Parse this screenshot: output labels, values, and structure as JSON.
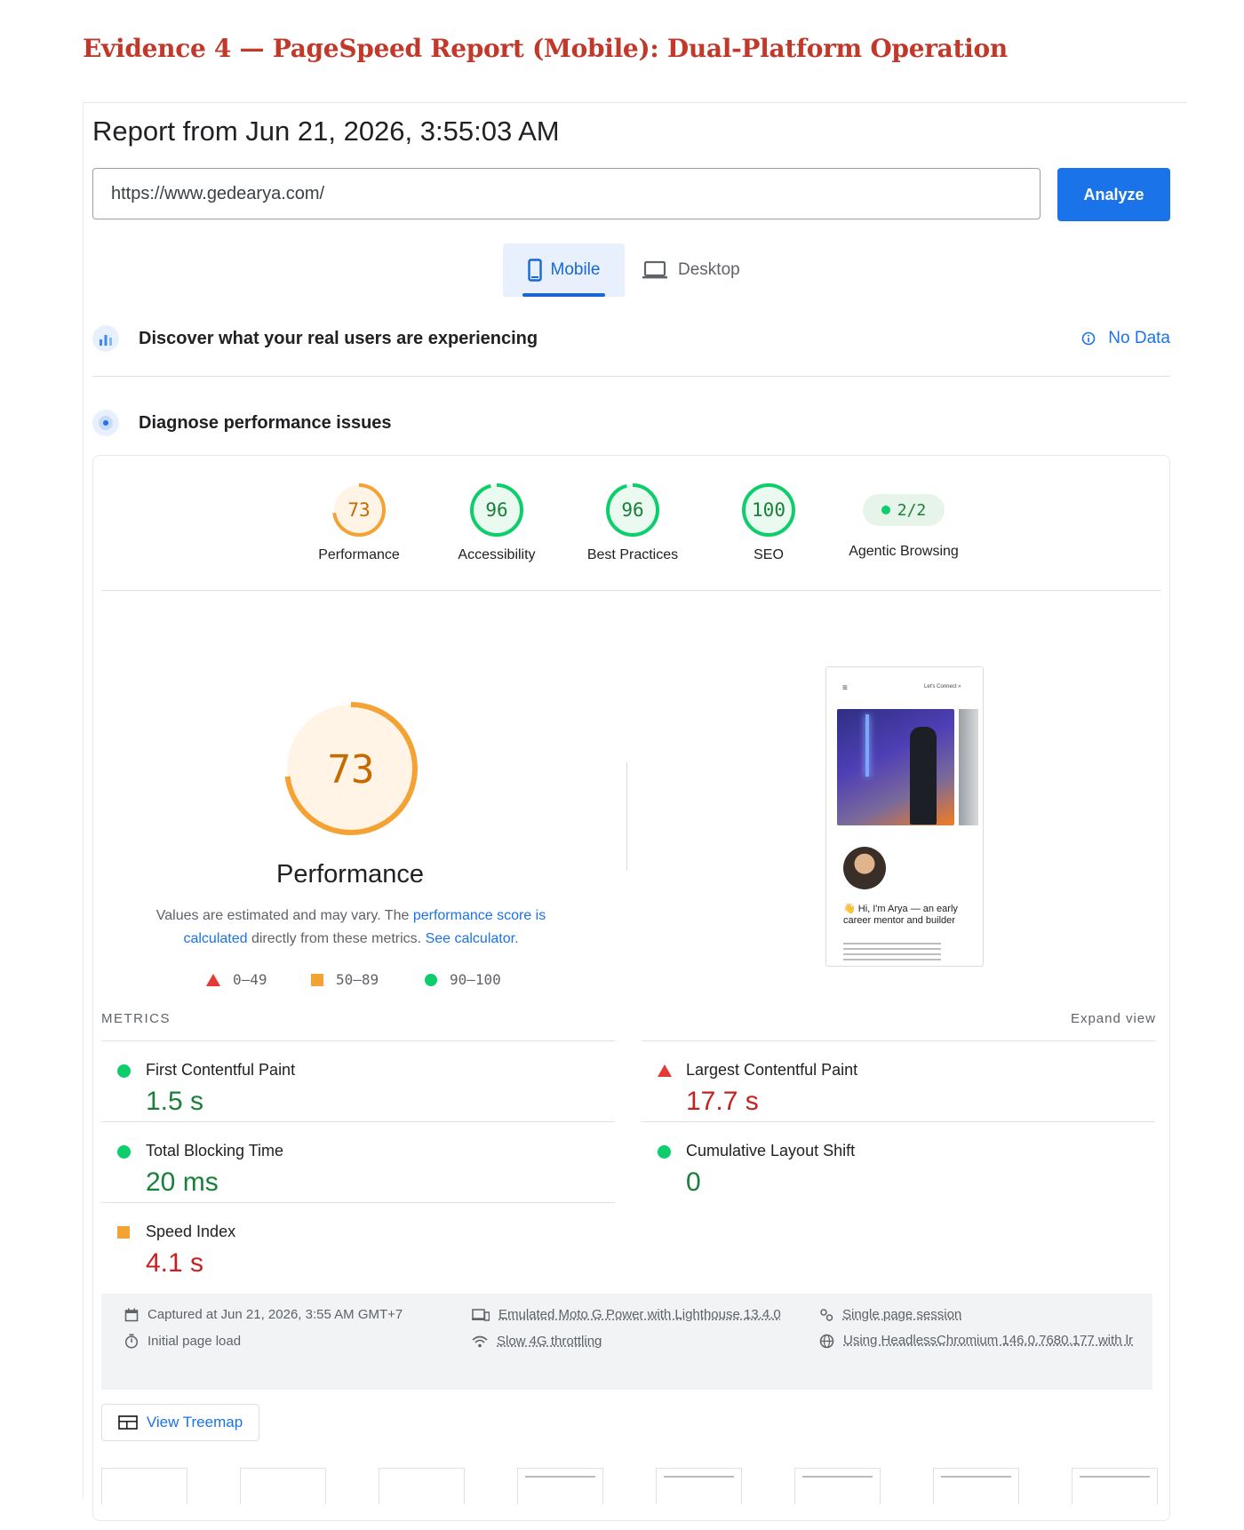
{
  "heading": "Evidence 4 — PageSpeed Report (Mobile): Dual-Platform Operation",
  "report": {
    "title": "Report from Jun 21, 2026, 3:55:03 AM",
    "url_value": "https://www.gedearya.com/",
    "analyze_label": "Analyze"
  },
  "tabs": {
    "mobile": "Mobile",
    "desktop": "Desktop"
  },
  "field_data": {
    "title": "Discover what your real users are experiencing",
    "status": "No Data"
  },
  "diagnose": {
    "title": "Diagnose performance issues"
  },
  "scores": [
    {
      "label": "Performance",
      "value": "73",
      "fraction": 0.73,
      "color": "#f4a234"
    },
    {
      "label": "Accessibility",
      "value": "96",
      "fraction": 0.96,
      "color": "#0cce6b"
    },
    {
      "label": "Best Practices",
      "value": "96",
      "fraction": 0.96,
      "color": "#0cce6b"
    },
    {
      "label": "SEO",
      "value": "100",
      "fraction": 1.0,
      "color": "#0cce6b"
    }
  ],
  "agentic": {
    "label": "Agentic Browsing",
    "value": "2/2"
  },
  "performance": {
    "score": "73",
    "label": "Performance",
    "note_prefix": "Values are estimated and may vary. The ",
    "note_link1": "performance score is calculated",
    "note_mid": " directly from these metrics. ",
    "note_link2": "See calculator."
  },
  "legend": {
    "poor": "0–49",
    "average": "50–89",
    "good": "90–100"
  },
  "metrics_header": "METRICS",
  "expand_view": "Expand view",
  "metrics": {
    "fcp": {
      "name": "First Contentful Paint",
      "value": "1.5 s",
      "status": "good"
    },
    "lcp": {
      "name": "Largest Contentful Paint",
      "value": "17.7 s",
      "status": "poor"
    },
    "tbt": {
      "name": "Total Blocking Time",
      "value": "20 ms",
      "status": "good"
    },
    "cls": {
      "name": "Cumulative Layout Shift",
      "value": "0",
      "status": "good"
    },
    "si": {
      "name": "Speed Index",
      "value": "4.1 s",
      "status": "average"
    }
  },
  "info": {
    "captured": "Captured at Jun 21, 2026, 3:55 AM GMT+7",
    "initial_load": "Initial page load",
    "emulated": "Emulated Moto G Power with Lighthouse 13.4.0",
    "throttling": "Slow 4G throttling",
    "session": "Single page session",
    "browser": "Using HeadlessChromium 146.0.7680.177 with lr"
  },
  "treemap_label": "View Treemap",
  "screenshot": {
    "nav_link": "Let's Connect »",
    "greeting": "👋 Hi, I'm Arya — an early career mentor and builder"
  },
  "colors": {
    "good": "#0cce6b",
    "average": "#f4a234",
    "poor": "#e53935",
    "accent": "#1a73e8",
    "heading": "#c0392b"
  }
}
